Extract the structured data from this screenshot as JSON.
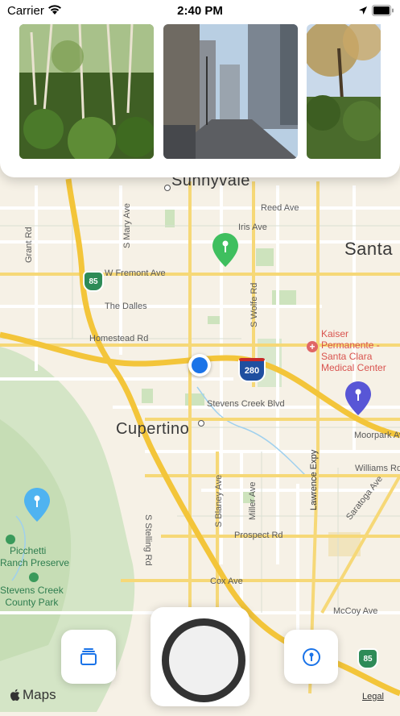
{
  "status_bar": {
    "carrier": "Carrier",
    "time": "2:40 PM"
  },
  "photos": [
    {
      "name": "forest-photo",
      "colors": [
        "#2f4a1c",
        "#6b8f3a"
      ]
    },
    {
      "name": "city-street-photo",
      "colors": [
        "#6b6f75",
        "#a9c4dd"
      ]
    },
    {
      "name": "tree-photo",
      "colors": [
        "#3e5a22",
        "#c7b07a"
      ]
    }
  ],
  "map": {
    "cities": {
      "sunnyvale": "Sunnyvale",
      "santa": "Santa",
      "cupertino": "Cupertino"
    },
    "streets": {
      "reed_ave": "Reed Ave",
      "iris_ave": "Iris Ave",
      "grant_rd": "Grant Rd",
      "s_mary_ave": "S Mary Ave",
      "w_fremont_ave": "W Fremont Ave",
      "the_dalles": "The Dalles",
      "homestead_rd": "Homestead Rd",
      "s_wolfe_rd": "S Wolfe Rd",
      "stevens_creek_blvd": "Stevens Creek Blvd",
      "moorpark_ave": "Moorpark Ave",
      "williams_rd": "Williams Rd",
      "s_stelling_rd": "S Stelling Rd",
      "s_blaney_ave": "S Blaney Ave",
      "miller_ave": "Miller Ave",
      "lawrence_expy": "Lawrence Expy",
      "saratoga_ave": "Saratoga Ave",
      "prospect_rd": "Prospect Rd",
      "cox_ave": "Cox Ave",
      "mccoy_ave": "McCoy Ave"
    },
    "shields": {
      "route_85_top": "85",
      "route_280": "280",
      "route_85_bottom": "85"
    },
    "poi": {
      "kaiser_line1": "Kaiser",
      "kaiser_line2": "Permanente -",
      "kaiser_line3": "Santa Clara",
      "kaiser_line4": "Medical Center"
    },
    "parks": {
      "picchetti_line1": "Picchetti",
      "picchetti_line2": "Ranch Preserve",
      "stevens_line1": "Stevens Creek",
      "stevens_line2": "County Park"
    },
    "pins": [
      {
        "name": "map-pin-green",
        "color": "#3fbf5f"
      },
      {
        "name": "map-pin-purple",
        "color": "#5856d6"
      },
      {
        "name": "map-pin-blue",
        "color": "#4fb3f0"
      }
    ],
    "user_location_color": "#1a73e8"
  },
  "footer": {
    "maps_logo": "Maps",
    "legal": "Legal"
  },
  "controls": {
    "left_icon": "stack-icon",
    "right_icon": "compass-pin-icon",
    "accent_color": "#1a73e8"
  }
}
